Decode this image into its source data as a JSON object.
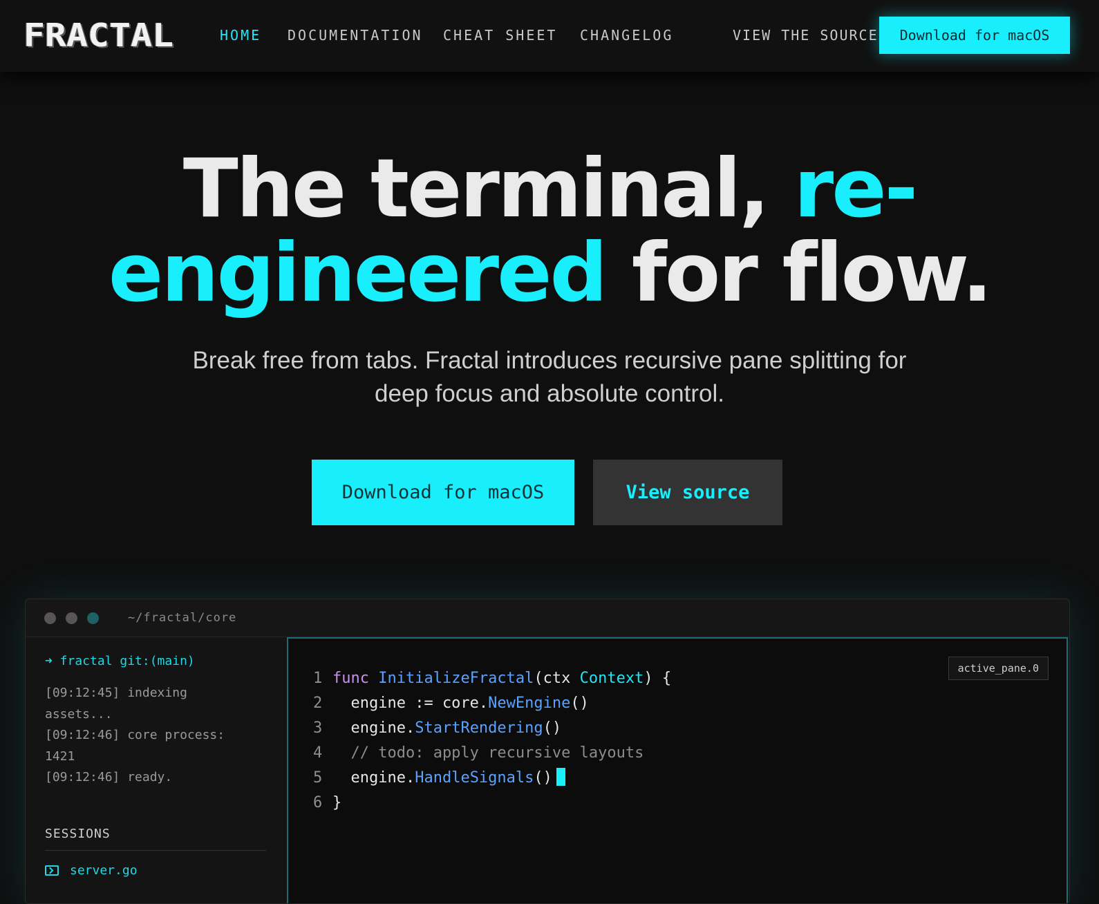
{
  "nav": {
    "logo": "FRACTAL",
    "links": [
      "HOME",
      "DOCUMENTATION",
      "CHEAT SHEET",
      "CHANGELOG"
    ],
    "view_source": "VIEW THE SOURCE",
    "cta": "Download for macOS"
  },
  "hero": {
    "title_part1": "The terminal, ",
    "title_accent1": "re-",
    "title_accent2": "engineered",
    "title_part2": " for flow.",
    "subtitle_line1": "Break free from tabs. Fractal introduces recursive pane splitting for",
    "subtitle_line2": "deep focus and absolute control.",
    "primary_button": "Download for macOS",
    "secondary_button": "View source"
  },
  "window": {
    "path": "~/fractal/core",
    "sidebar": {
      "prompt": "➜ fractal git:(main)",
      "log": [
        "[09:12:45] indexing",
        "assets...",
        "[09:12:46] core process:",
        "1421",
        "[09:12:46] ready."
      ],
      "sessions_label": "SESSIONS",
      "sessions": [
        "server.go"
      ]
    },
    "editor": {
      "badge": "active_pane.0",
      "line_numbers": [
        "1",
        "2",
        "3",
        "4",
        "5",
        "6"
      ],
      "code": {
        "l1_kw": "func",
        "l1_fn": "InitializeFractal",
        "l1_open": "(ctx ",
        "l1_type": "Context",
        "l1_close": ") {",
        "l2_pre": "  engine := core.",
        "l2_fn": "NewEngine",
        "l2_post": "()",
        "l3_pre": "  engine.",
        "l3_fn": "StartRendering",
        "l3_post": "()",
        "l4_comment": "  // todo: apply recursive layouts",
        "l5_pre": "  engine.",
        "l5_fn": "HandleSignals",
        "l5_post": "()",
        "l6": "}"
      }
    }
  }
}
